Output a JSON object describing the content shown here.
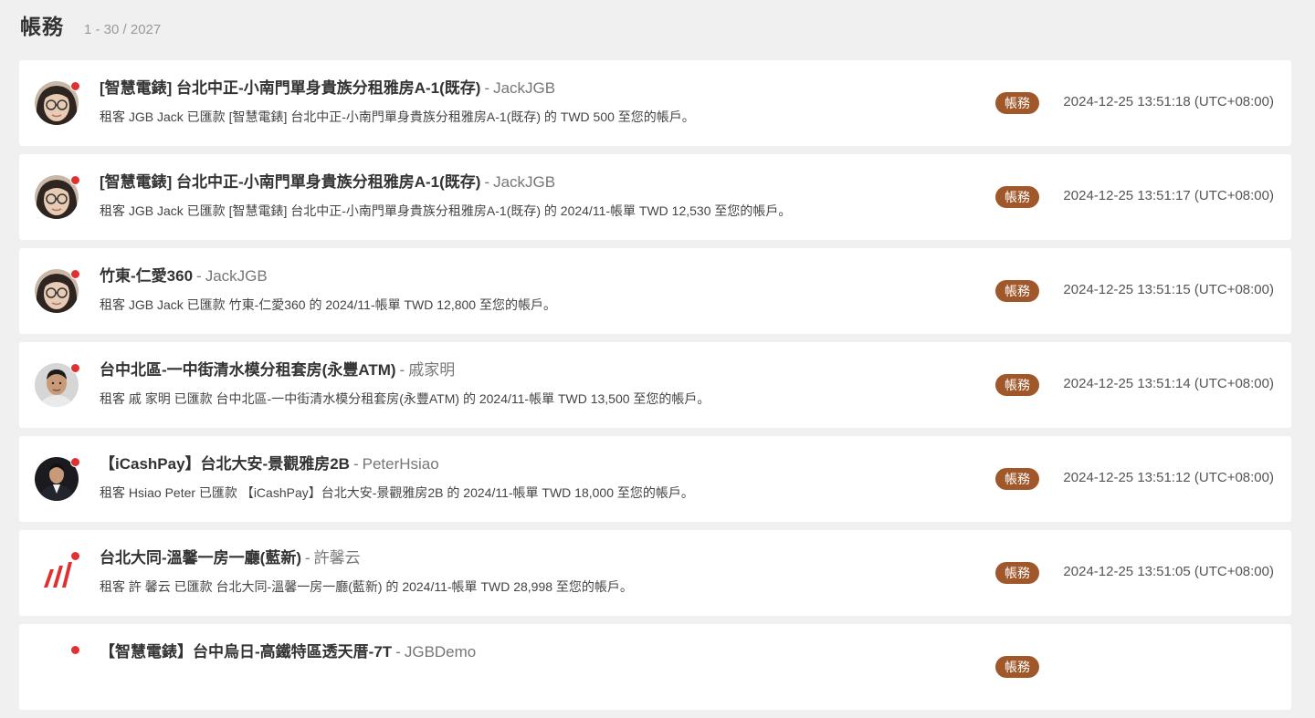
{
  "header": {
    "title": "帳務",
    "count": "1 - 30 / 2027"
  },
  "items": [
    {
      "avatar": "woman-glasses",
      "title": "[智慧電錶] 台北中正-小南門單身貴族分租雅房A-1(既存)",
      "separator": "-",
      "author": "JackJGB",
      "description": "租客 JGB Jack 已匯款 [智慧電錶] 台北中正-小南門單身貴族分租雅房A-1(既存) 的 TWD 500 至您的帳戶。",
      "badge": "帳務",
      "time": "2024-12-25 13:51:18 (UTC+08:00)"
    },
    {
      "avatar": "woman-glasses",
      "title": "[智慧電錶] 台北中正-小南門單身貴族分租雅房A-1(既存)",
      "separator": "-",
      "author": "JackJGB",
      "description": "租客 JGB Jack 已匯款 [智慧電錶] 台北中正-小南門單身貴族分租雅房A-1(既存) 的 2024/11-帳單 TWD 12,530 至您的帳戶。",
      "badge": "帳務",
      "time": "2024-12-25 13:51:17 (UTC+08:00)"
    },
    {
      "avatar": "woman-glasses",
      "title": "竹東-仁愛360",
      "separator": "-",
      "author": "JackJGB",
      "description": "租客 JGB Jack 已匯款 竹東-仁愛360 的 2024/11-帳單 TWD 12,800 至您的帳戶。",
      "badge": "帳務",
      "time": "2024-12-25 13:51:15 (UTC+08:00)"
    },
    {
      "avatar": "man-portrait",
      "title": "台中北區-一中街清水模分租套房(永豐ATM)",
      "separator": "-",
      "author": "戚家明",
      "description": "租客 戚 家明 已匯款 台中北區-一中街清水模分租套房(永豐ATM) 的 2024/11-帳單 TWD 13,500 至您的帳戶。",
      "badge": "帳務",
      "time": "2024-12-25 13:51:14 (UTC+08:00)"
    },
    {
      "avatar": "man-suit",
      "title": "【iCashPay】台北大安-景觀雅房2B",
      "separator": "-",
      "author": "PeterHsiao",
      "description": "租客 Hsiao Peter 已匯款 【iCashPay】台北大安-景觀雅房2B 的 2024/11-帳單 TWD 18,000 至您的帳戶。",
      "badge": "帳務",
      "time": "2024-12-25 13:51:12 (UTC+08:00)"
    },
    {
      "avatar": "brand-logo",
      "title": "台北大同-溫馨一房一廳(藍新)",
      "separator": "-",
      "author": "許馨云",
      "description": "租客 許 馨云 已匯款 台北大同-溫馨一房一廳(藍新) 的 2024/11-帳單 TWD 28,998 至您的帳戶。",
      "badge": "帳務",
      "time": "2024-12-25 13:51:05 (UTC+08:00)"
    },
    {
      "avatar": "default",
      "title": "【智慧電錶】台中烏日-高鐵特區透天厝-7T",
      "separator": "-",
      "author": "JGBDemo",
      "description": "",
      "badge": "帳務",
      "time": ""
    }
  ],
  "colors": {
    "badge": "#a0582a",
    "dot": "#e03131",
    "background": "#f0f0f0"
  }
}
